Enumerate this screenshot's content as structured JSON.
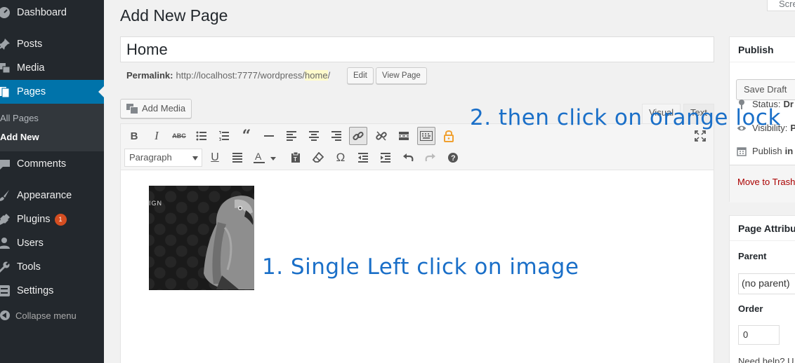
{
  "sidebar": {
    "items": [
      {
        "label": "Dashboard",
        "icon": "dashboard-icon"
      },
      {
        "label": "Posts",
        "icon": "pin-icon"
      },
      {
        "label": "Media",
        "icon": "media-icon"
      },
      {
        "label": "Pages",
        "icon": "pages-icon"
      },
      {
        "label": "Comments",
        "icon": "comments-icon"
      },
      {
        "label": "Appearance",
        "icon": "brush-icon"
      },
      {
        "label": "Plugins",
        "icon": "plugin-icon",
        "badge": "1"
      },
      {
        "label": "Users",
        "icon": "users-icon"
      },
      {
        "label": "Tools",
        "icon": "wrench-icon"
      },
      {
        "label": "Settings",
        "icon": "settings-icon"
      }
    ],
    "submenu": [
      "All Pages",
      "Add New"
    ],
    "collapse": "Collapse menu"
  },
  "screen_options": "Scre",
  "main": {
    "title": "Add New Page",
    "post_title": "Home",
    "permalink_label": "Permalink:",
    "permalink_base": "http://localhost:7777/wordpress/",
    "permalink_slug": "home",
    "permalink_end": "/",
    "edit_label": "Edit",
    "view_label": "View Page",
    "add_media": "Add Media",
    "tab_visual": "Visual",
    "tab_text": "Text",
    "format_value": "Paragraph"
  },
  "publish": {
    "title": "Publish",
    "save_draft": "Save Draft",
    "status_label": "Status:",
    "status_value": "Dr",
    "visibility_label": "Visibility:",
    "visibility_value": "P",
    "publish_label": "Publish",
    "publish_value": "in",
    "trash": "Move to Trash"
  },
  "attributes": {
    "title": "Page Attribu",
    "parent_label": "Parent",
    "parent_value": "(no parent)",
    "order_label": "Order",
    "order_value": "0",
    "help": "Need help? U"
  },
  "image": {
    "partial_text": "IGN"
  },
  "annotations": {
    "step1": "1. Single Left click on image",
    "step2": "2. then click on orange lock"
  },
  "colors": {
    "sidebar_bg": "#23282d",
    "active_menu": "#0073aa",
    "lock_icon": "#f0a030",
    "annotation": "#1a6fc8",
    "badge": "#d54e21"
  }
}
